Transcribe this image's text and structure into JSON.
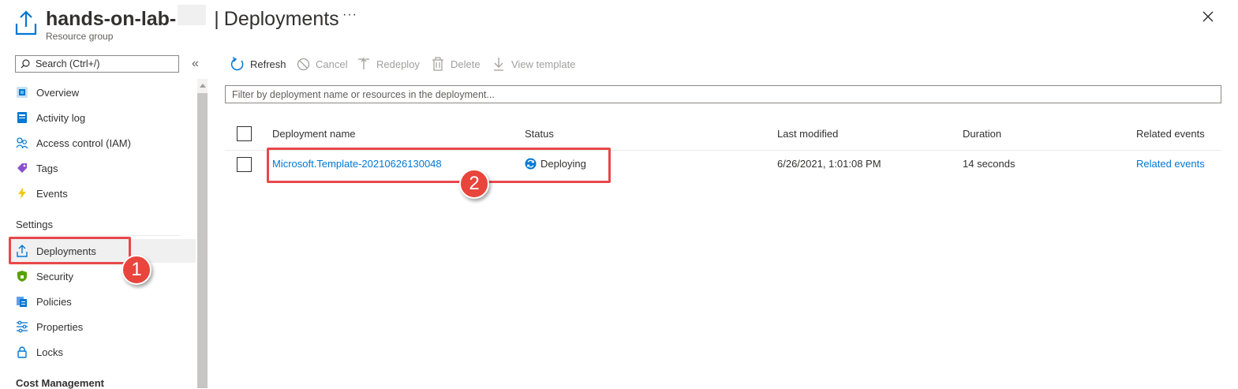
{
  "header": {
    "title": "hands-on-lab-",
    "separator": "|",
    "page": "Deployments",
    "more": "···",
    "subtitle": "Resource group"
  },
  "sidebar": {
    "search_placeholder": "Search (Ctrl+/)",
    "collapse": "«",
    "items_top": [
      {
        "label": "Overview",
        "icon": "overview-icon"
      },
      {
        "label": "Activity log",
        "icon": "activity-log-icon"
      },
      {
        "label": "Access control (IAM)",
        "icon": "iam-icon"
      },
      {
        "label": "Tags",
        "icon": "tag-icon"
      },
      {
        "label": "Events",
        "icon": "lightning-icon"
      }
    ],
    "section_settings": "Settings",
    "items_settings": [
      {
        "label": "Deployments",
        "icon": "deployments-icon",
        "active": true
      },
      {
        "label": "Security",
        "icon": "shield-icon"
      },
      {
        "label": "Policies",
        "icon": "policies-icon"
      },
      {
        "label": "Properties",
        "icon": "properties-icon"
      },
      {
        "label": "Locks",
        "icon": "lock-icon"
      }
    ],
    "section_cost": "Cost Management"
  },
  "toolbar": {
    "refresh": "Refresh",
    "cancel": "Cancel",
    "redeploy": "Redeploy",
    "delete": "Delete",
    "view_template": "View template"
  },
  "filter": {
    "placeholder": "Filter by deployment name or resources in the deployment..."
  },
  "table": {
    "columns": [
      "Deployment name",
      "Status",
      "Last modified",
      "Duration",
      "Related events"
    ],
    "rows": [
      {
        "name": "Microsoft.Template-20210626130048",
        "status": "Deploying",
        "last_modified": "6/26/2021, 1:01:08 PM",
        "duration": "14 seconds",
        "related_events": "Related events"
      }
    ]
  },
  "annotations": {
    "step1": "1",
    "step2": "2"
  },
  "colors": {
    "accent": "#0078d4",
    "highlight": "#e8484a",
    "badge": "#e8453c"
  }
}
